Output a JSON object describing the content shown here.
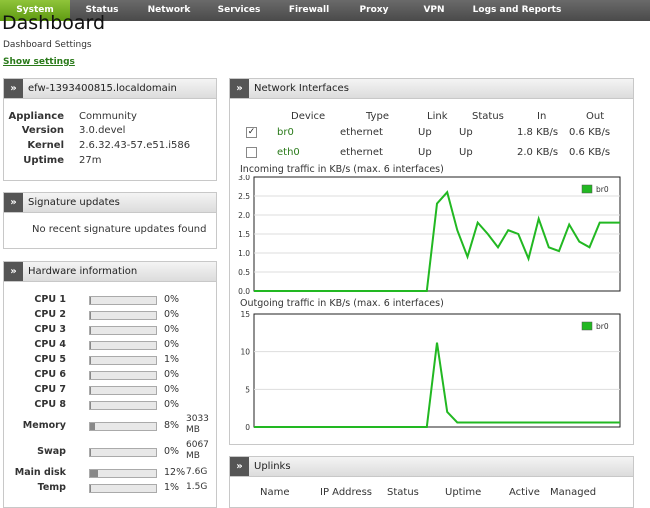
{
  "nav": [
    {
      "label": "System",
      "active": true
    },
    {
      "label": "Status",
      "active": false
    },
    {
      "label": "Network",
      "active": false
    },
    {
      "label": "Services",
      "active": false
    },
    {
      "label": "Firewall",
      "active": false
    },
    {
      "label": "Proxy",
      "active": false
    },
    {
      "label": "VPN",
      "active": false
    },
    {
      "label": "Logs and Reports",
      "active": false
    }
  ],
  "page": {
    "title": "Dashboard",
    "settings_label": "Dashboard Settings",
    "show_settings": "Show settings"
  },
  "host": {
    "title": "efw-1393400815.localdomain",
    "rows": [
      {
        "k": "Appliance",
        "v": "Community"
      },
      {
        "k": "Version",
        "v": "3.0.devel"
      },
      {
        "k": "Kernel",
        "v": "2.6.32.43-57.e51.i586"
      },
      {
        "k": "Uptime",
        "v": "27m"
      }
    ]
  },
  "signatures": {
    "title": "Signature updates",
    "message": "No recent signature updates found"
  },
  "hardware": {
    "title": "Hardware information",
    "rows": [
      {
        "label": "CPU 1",
        "pct": "0%",
        "value": 0
      },
      {
        "label": "CPU 2",
        "pct": "0%",
        "value": 0
      },
      {
        "label": "CPU 3",
        "pct": "0%",
        "value": 0
      },
      {
        "label": "CPU 4",
        "pct": "0%",
        "value": 0
      },
      {
        "label": "CPU 5",
        "pct": "1%",
        "value": 1
      },
      {
        "label": "CPU 6",
        "pct": "0%",
        "value": 0
      },
      {
        "label": "CPU 7",
        "pct": "0%",
        "value": 0
      },
      {
        "label": "CPU 8",
        "pct": "0%",
        "value": 0
      },
      {
        "label": "Memory",
        "pct": "8%",
        "value": 8,
        "size1": "3033",
        "size2": "MB"
      },
      {
        "label": "Swap",
        "pct": "0%",
        "value": 0,
        "size1": "6067",
        "size2": "MB"
      },
      {
        "label": "Main disk",
        "pct": "12%",
        "value": 12,
        "size1": "7.6G"
      },
      {
        "label": "Temp",
        "pct": "1%",
        "value": 1,
        "size1": "1.5G"
      }
    ]
  },
  "network": {
    "title": "Network Interfaces",
    "headers": [
      "Device",
      "Type",
      "Link",
      "Status",
      "In",
      "Out"
    ],
    "rows": [
      {
        "checked": true,
        "device": "br0",
        "type": "ethernet",
        "link": "Up",
        "status": "Up",
        "in": "1.8 KB/s",
        "out": "0.6 KB/s"
      },
      {
        "checked": false,
        "device": "eth0",
        "type": "ethernet",
        "link": "Up",
        "status": "Up",
        "in": "2.0 KB/s",
        "out": "0.6 KB/s"
      }
    ],
    "check_mark": "✓"
  },
  "chart_data": [
    {
      "type": "line",
      "title": "Incoming traffic in KB/s (max. 6 interfaces)",
      "ylim": [
        0,
        3.0
      ],
      "yticks": [
        "0.0",
        "0.5",
        "1.0",
        "1.5",
        "2.0",
        "2.5",
        "3.0"
      ],
      "series": [
        {
          "name": "br0",
          "color": "#22b822",
          "x": [
            0,
            1,
            2,
            3,
            4,
            5,
            6,
            7,
            8,
            9,
            10,
            11,
            12,
            13,
            14,
            15,
            16,
            17,
            18,
            19,
            20,
            21,
            22,
            23,
            24,
            25,
            26,
            27,
            28,
            29,
            30,
            31,
            32,
            33,
            34,
            35,
            36
          ],
          "values": [
            0,
            0,
            0,
            0,
            0,
            0,
            0,
            0,
            0,
            0,
            0,
            0,
            0,
            0,
            0,
            0,
            0,
            0,
            2.3,
            2.6,
            1.6,
            0.9,
            1.8,
            1.5,
            1.15,
            1.6,
            1.5,
            0.85,
            1.9,
            1.15,
            1.05,
            1.75,
            1.3,
            1.15,
            1.8,
            1.8,
            1.8
          ]
        }
      ]
    },
    {
      "type": "line",
      "title": "Outgoing traffic in KB/s (max. 6 interfaces)",
      "ylim": [
        0,
        15
      ],
      "yticks": [
        "0",
        "5",
        "10",
        "15"
      ],
      "series": [
        {
          "name": "br0",
          "color": "#22b822",
          "x": [
            0,
            1,
            2,
            3,
            4,
            5,
            6,
            7,
            8,
            9,
            10,
            11,
            12,
            13,
            14,
            15,
            16,
            17,
            18,
            19,
            20,
            21,
            22,
            23,
            24,
            25,
            26,
            27,
            28,
            29,
            30,
            31,
            32,
            33,
            34,
            35,
            36
          ],
          "values": [
            0,
            0,
            0,
            0,
            0,
            0,
            0,
            0,
            0,
            0,
            0,
            0,
            0,
            0,
            0,
            0,
            0,
            0,
            11.2,
            2.0,
            0.6,
            0.6,
            0.6,
            0.6,
            0.6,
            0.6,
            0.6,
            0.6,
            0.6,
            0.6,
            0.6,
            0.6,
            0.6,
            0.6,
            0.6,
            0.6,
            0.6
          ]
        }
      ]
    }
  ],
  "uplinks": {
    "title": "Uplinks",
    "headers": [
      "Name",
      "IP Address",
      "Status",
      "Uptime",
      "Active",
      "Managed"
    ]
  }
}
